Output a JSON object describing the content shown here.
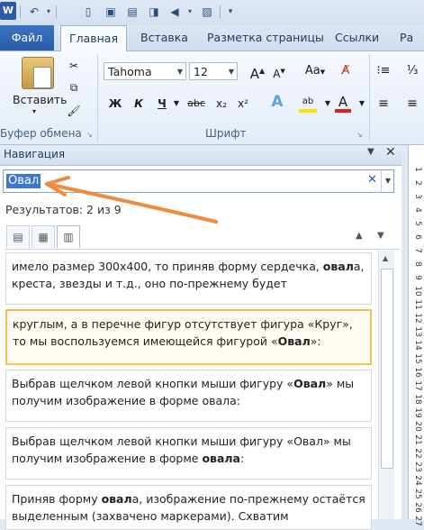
{
  "tabs": {
    "file": "Файл",
    "home": "Главная",
    "insert": "Вставка",
    "layout": "Разметка страницы",
    "links": "Ссылки",
    "more": "Ра"
  },
  "ribbon": {
    "paste_label": "Вставить",
    "clipboard_group": "Буфер обмена",
    "font_group": "Шрифт",
    "font_name": "Tahoma",
    "font_size": "12",
    "bold": "Ж",
    "italic": "К",
    "underline": "Ч",
    "strike": "abc",
    "subscript": "x₂",
    "superscript": "x²",
    "grow": "A",
    "case": "Aa",
    "text_effect": "A",
    "highlight": "ab",
    "font_color": "A",
    "colors": {
      "highlight": "#f5e400",
      "font_color": "#e0201c",
      "accent": "#f08a3c"
    }
  },
  "nav": {
    "title": "Навигация",
    "search_value": "Овал",
    "results": "Результатов: 2 из 9",
    "cards": [
      {
        "pre": "имело размер 300x400, то приняв форму сердечка, ",
        "bold": "овал",
        "post": "а, креста, звезды и т.д., оно по-прежнему будет"
      },
      {
        "pre": "круглым, а в перечне фигур отсутствует фигура «Круг», то мы воспользуемся имеющейся фигурой «",
        "bold": "Овал",
        "post": "»:"
      },
      {
        "pre": "Выбрав щелчком левой кнопки мыши фигуру «",
        "bold": "Овал",
        "post": "» мы получим изображение в форме овала:"
      },
      {
        "pre": "Выбрав щелчком левой кнопки мыши фигуру «Овал» мы получим изображение в форме ",
        "bold": "овала",
        "post": ":"
      },
      {
        "pre": "Приняв форму ",
        "bold": "овал",
        "post": "а, изображение по-прежнему остаётся выделенным (захвачено маркерами). Схватим"
      }
    ]
  },
  "ruler_numbers": [
    "1",
    "2",
    "3",
    "4",
    "5",
    "6",
    "7",
    "8",
    "9",
    "10",
    "11",
    "12",
    "13",
    "14",
    "15",
    "16",
    "17",
    "18",
    "19",
    "20",
    "21",
    "22",
    "23",
    "24",
    "25",
    "26",
    "27"
  ]
}
